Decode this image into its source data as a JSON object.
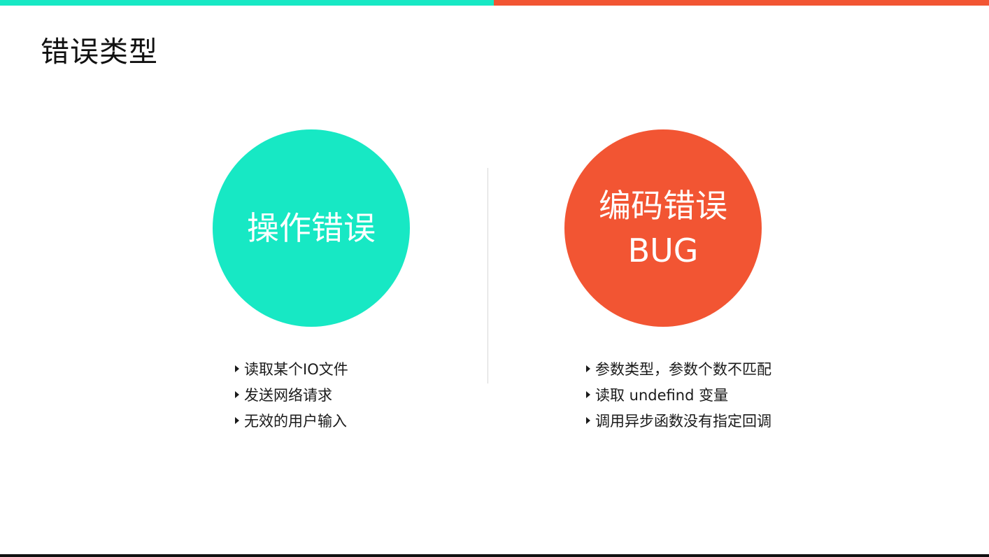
{
  "colors": {
    "accent_green": "#17e8c4",
    "accent_red": "#f25533",
    "bottom_bar": "#111111"
  },
  "slide": {
    "title": "错误类型"
  },
  "left": {
    "circle_label": "操作错误",
    "items": [
      {
        "text": "读取某个IO文件",
        "icon": "caret-right-icon"
      },
      {
        "text": "发送网络请求",
        "icon": "caret-right-icon"
      },
      {
        "text": "无效的用户输入",
        "icon": "caret-right-icon"
      }
    ]
  },
  "right": {
    "circle_label": "编码错误",
    "circle_sub": "BUG",
    "items": [
      {
        "text": "参数类型，参数个数不匹配",
        "icon": "caret-right-icon"
      },
      {
        "text": "读取 undefind 变量",
        "icon": "caret-right-icon"
      },
      {
        "text": "调用异步函数没有指定回调",
        "icon": "caret-right-icon"
      }
    ]
  }
}
